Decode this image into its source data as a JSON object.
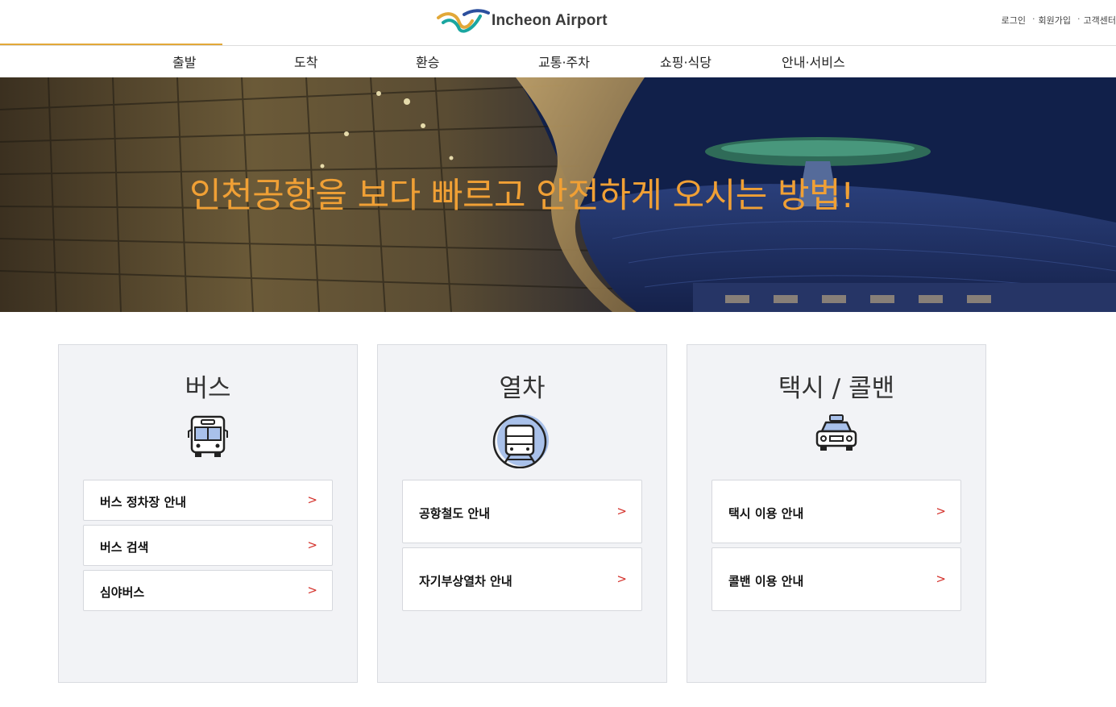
{
  "header": {
    "logo_text": "Incheon Airport",
    "util_links": [
      "로그인",
      "회원가입",
      "고객센터"
    ],
    "nav": [
      "출발",
      "도착",
      "환승",
      "교통·주차",
      "쇼핑·식당",
      "안내·서비스"
    ],
    "active_nav": "출발"
  },
  "hero": {
    "title": "인천공항을 보다 빠르고 안전하게 오시는 방법!"
  },
  "cards": {
    "bus": {
      "title": "버스",
      "icon": "bus-icon",
      "links": [
        "버스 정차장 안내",
        "버스 검색",
        "심야버스"
      ]
    },
    "train": {
      "title": "열차",
      "icon": "train-icon",
      "links": [
        "공항철도 안내",
        "자기부상열차 안내"
      ]
    },
    "taxi": {
      "title": "택시 / 콜밴",
      "icon": "taxi-icon",
      "links": [
        "택시 이용 안내",
        "콜밴 이용 안내"
      ]
    }
  },
  "colors": {
    "accent_gold": "#e2a838",
    "hero_text": "#f0a035",
    "chevron_red": "#d4322c",
    "card_bg": "#f2f3f6",
    "icon_fill": "#a9c1ea"
  },
  "chevron_glyph": ">"
}
